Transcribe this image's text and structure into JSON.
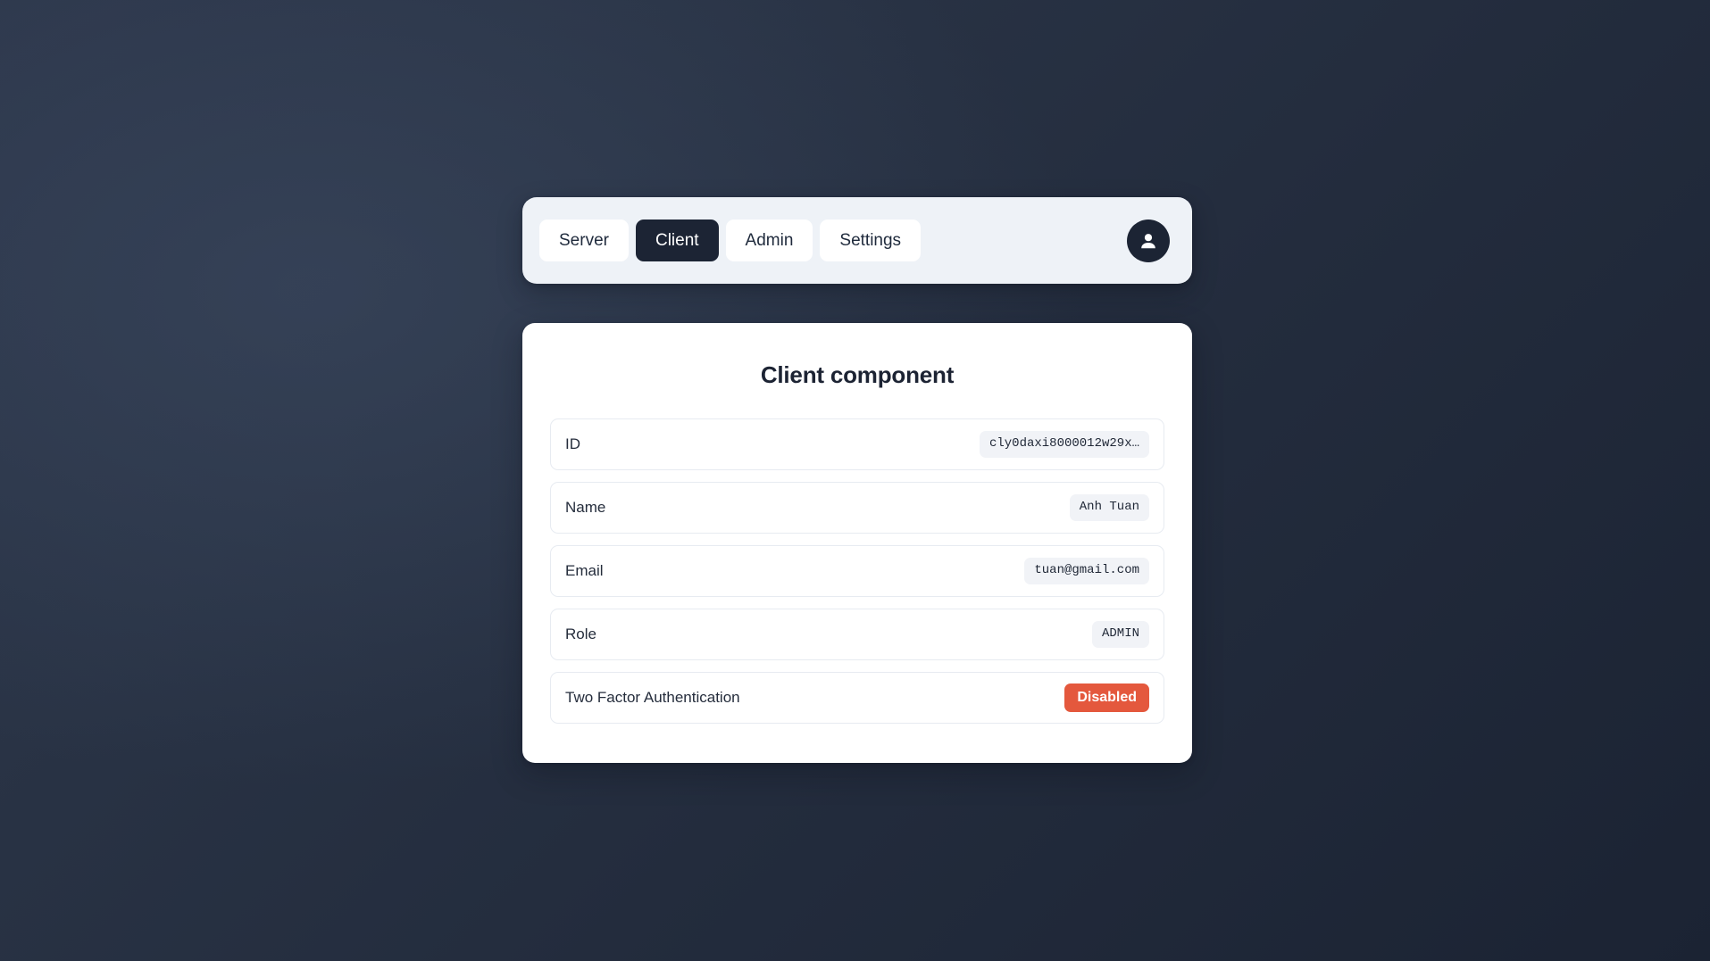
{
  "navbar": {
    "tabs": [
      {
        "label": "Server",
        "active": false
      },
      {
        "label": "Client",
        "active": true
      },
      {
        "label": "Admin",
        "active": false
      },
      {
        "label": "Settings",
        "active": false
      }
    ],
    "avatar_icon": "user-icon"
  },
  "card": {
    "title": "Client component",
    "rows": [
      {
        "label": "ID",
        "value": "cly0daxi8000012w29x…",
        "style": "mono"
      },
      {
        "label": "Name",
        "value": "Anh Tuan",
        "style": "mono"
      },
      {
        "label": "Email",
        "value": "tuan@gmail.com",
        "style": "mono"
      },
      {
        "label": "Role",
        "value": "ADMIN",
        "style": "mono"
      },
      {
        "label": "Two Factor Authentication",
        "value": "Disabled",
        "style": "danger"
      }
    ]
  },
  "colors": {
    "page_background_top": "#2c364a",
    "page_background_bottom": "#1b2333",
    "navbar_background": "#eef2f7",
    "active_tab": "#1c2434",
    "card_background": "#ffffff",
    "badge_background": "#f1f3f7",
    "danger_badge": "#e4583d",
    "text_dark": "#1c2333"
  }
}
